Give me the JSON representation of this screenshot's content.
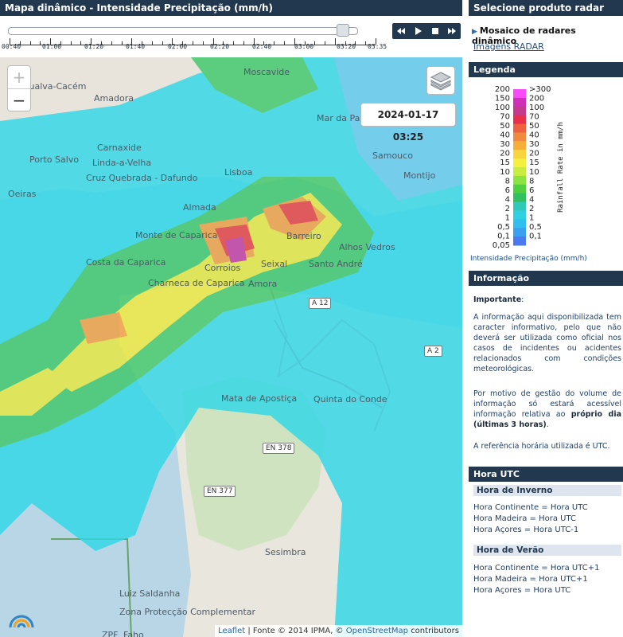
{
  "header": {
    "title": "Mapa dinâmico - Intensidade Precipitação (mm/h)"
  },
  "timeline": {
    "labels": [
      "00:40",
      "01:00",
      "01:20",
      "01:40",
      "02:00",
      "02:20",
      "02:40",
      "03:00",
      "03:20",
      "03:35"
    ],
    "progress": 0.96
  },
  "map": {
    "timestamp": "2024-01-17 03:25",
    "zoom_in": "+",
    "zoom_out": "−",
    "places": [
      "Agualva-Cacém",
      "Amadora",
      "Moscavide",
      "Carnaxide",
      "Linda-a-Velha",
      "Porto Salvo",
      "Cruz Quebrada - Dafundo",
      "Oeiras",
      "Lisboa",
      "Samouco",
      "Montijo",
      "Almada",
      "Monte de Caparica",
      "Barreiro",
      "Alhos Vedros",
      "Costa da Caparica",
      "Corroios",
      "Seixal",
      "Santo André",
      "Amora",
      "Charneca de Caparica",
      "Quinta do Conde",
      "Mata de Apostiça",
      "EN 378",
      "EN 377",
      "Sesimbra",
      "Luiz Saldanha",
      "Zona Protecção Complementar",
      "ZPF",
      "Faho",
      "A 2",
      "A 12",
      "Mar da Palha"
    ],
    "attribution": {
      "leaflet": "Leaflet",
      "source": "Fonte © 2014 IPMA, ©",
      "osm": "OpenStreetMap",
      "contributors": "contributors"
    }
  },
  "right_panel": {
    "title": "Selecione produto radar",
    "radar_option": "Mosaico de radares dinâmico",
    "images_link": "Imagens RADAR",
    "legend": {
      "title": "Legenda",
      "left_labels": [
        "200",
        "150",
        "100",
        "70",
        "50",
        "40",
        "30",
        "20",
        "15",
        "10",
        "8",
        "6",
        "4",
        "2",
        "1",
        "0,5",
        "0,1",
        "0,05"
      ],
      "right_labels": [
        ">300",
        "200",
        "100",
        "70",
        "50",
        "40",
        "30",
        "20",
        "15",
        "10",
        "8",
        "6",
        "4",
        "2",
        "1",
        "0,5",
        "0,1"
      ],
      "axis_label": "Rainfall Rate in mm/h",
      "caption": "Intensidade Precipitação (mm/h)",
      "colors": [
        "#f84cf8",
        "#d02fb8",
        "#c43a8c",
        "#e8304a",
        "#ee6040",
        "#f08a3e",
        "#f6b03a",
        "#f8d43e",
        "#f4f040",
        "#c8ec40",
        "#8ce440",
        "#50d040",
        "#30c060",
        "#30c8b8",
        "#30d0e0",
        "#30c0f0",
        "#3aa0f0",
        "#4a7af0"
      ]
    },
    "info": {
      "title": "Informação",
      "important": "Importante",
      "p1": "A informação aqui disponibilizada tem caracter informativo, pelo que não deverá ser utilizada como oficial nos casos de incidentes ou acidentes relacionados com condições meteorológicas.",
      "p2_a": "Por motivo de gestão do volume de informação só estará acessível informação relativa ao",
      "p2_b": "próprio dia (últimas 3 horas)",
      "p2_c": ".",
      "p3": "A referência horária utilizada é UTC."
    },
    "utc": {
      "title": "Hora UTC",
      "winter_title": "Hora de Inverno",
      "winter": [
        "Hora Continente = Hora UTC",
        "Hora Madeira = Hora UTC",
        "Hora Açores = Hora UTC-1"
      ],
      "summer_title": "Hora de Verão",
      "summer": [
        "Hora Continente = Hora UTC+1",
        "Hora Madeira = Hora UTC+1",
        "Hora Açores = Hora UTC"
      ]
    }
  }
}
